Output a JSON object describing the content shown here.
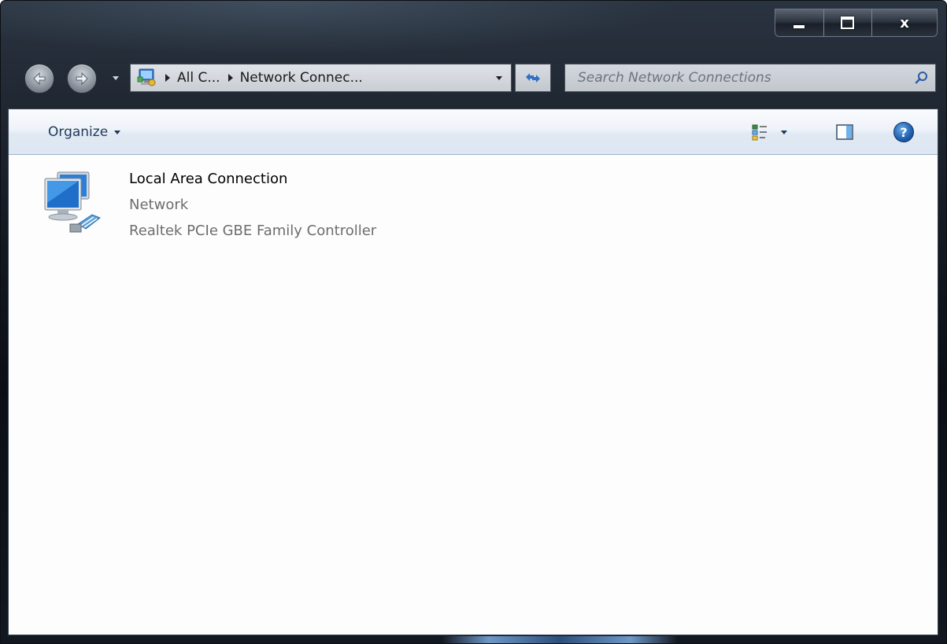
{
  "window": {
    "caption": {
      "minimize_label": "minimize",
      "maximize_label": "maximize",
      "close_symbol": "x"
    }
  },
  "nav": {
    "back_icon": "back-arrow-icon",
    "forward_icon": "forward-arrow-icon"
  },
  "address": {
    "breadcrumbs": [
      "All C...",
      "Network Connec..."
    ],
    "icon": "control-panel-icon"
  },
  "search": {
    "placeholder": "Search Network Connections"
  },
  "toolbar": {
    "organize_label": "Organize",
    "help_symbol": "?"
  },
  "items": [
    {
      "name": "Local Area Connection",
      "status": "Network",
      "device": "Realtek PCIe GBE Family Controller",
      "icon": "network-connection-icon"
    }
  ],
  "colors": {
    "frame_dark": "#141a22",
    "toolbar_text": "#1e395b",
    "secondary_text": "#6d6d6d"
  }
}
